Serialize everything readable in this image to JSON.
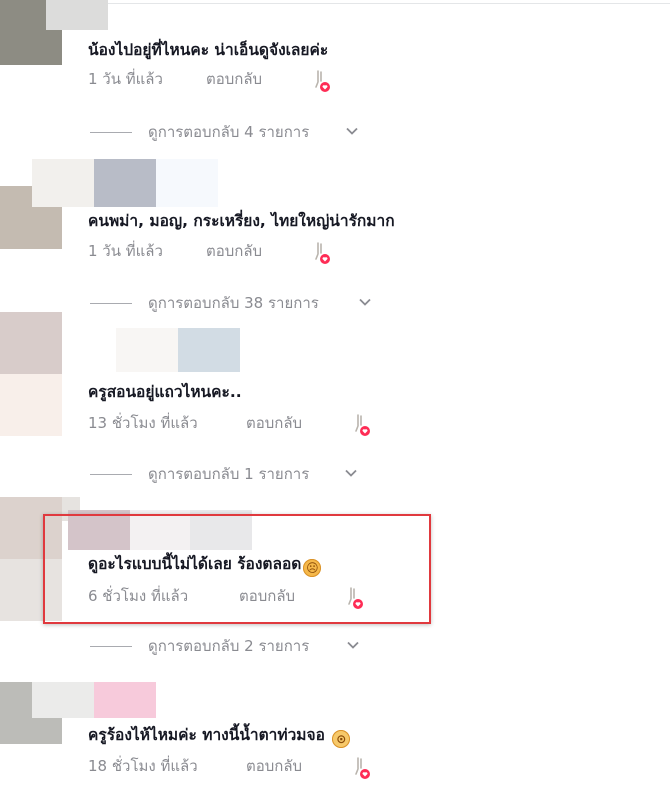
{
  "comments": [
    {
      "text": "น้องไปอยู่ที่ไหนคะ น่าเอ็นดูจังเลยค่ะ",
      "time": "1 วัน ที่แล้ว",
      "reply": "ตอบกลับ",
      "view_replies": "ดูการตอบกลับ 4 รายการ",
      "emoji": ""
    },
    {
      "text": "คนพม่า, มอญ, กระเหรี่ยง, ไทยใหญ่น่ารักมาก",
      "time": "1 วัน ที่แล้ว",
      "reply": "ตอบกลับ",
      "view_replies": "ดูการตอบกลับ 38 รายการ",
      "emoji": ""
    },
    {
      "text": "ครูสอนอยู่แถวไหนคะ..",
      "time": "13 ชั่วโมง ที่แล้ว",
      "reply": "ตอบกลับ",
      "view_replies": "ดูการตอบกลับ 1 รายการ",
      "emoji": ""
    },
    {
      "text": "ดูอะไรแบบนี้ไม่ได้เลย ร้องตลอด",
      "time": "6 ชั่วโมง ที่แล้ว",
      "reply": "ตอบกลับ",
      "view_replies": "ดูการตอบกลับ 2 รายการ",
      "emoji": "sad-face",
      "highlighted": true
    },
    {
      "text": "ครูร้องไห้ไหมค่ะ ทางนี้น้ำตาท่วมจอ",
      "time": "18 ชั่วโมง ที่แล้ว",
      "reply": "ตอบกลับ",
      "emoji": "flushed-face"
    }
  ],
  "colors": {
    "text": "#161823",
    "meta": "#8a8b91",
    "like_heart": "#fe2c55",
    "highlight_border": "#e0393e"
  }
}
